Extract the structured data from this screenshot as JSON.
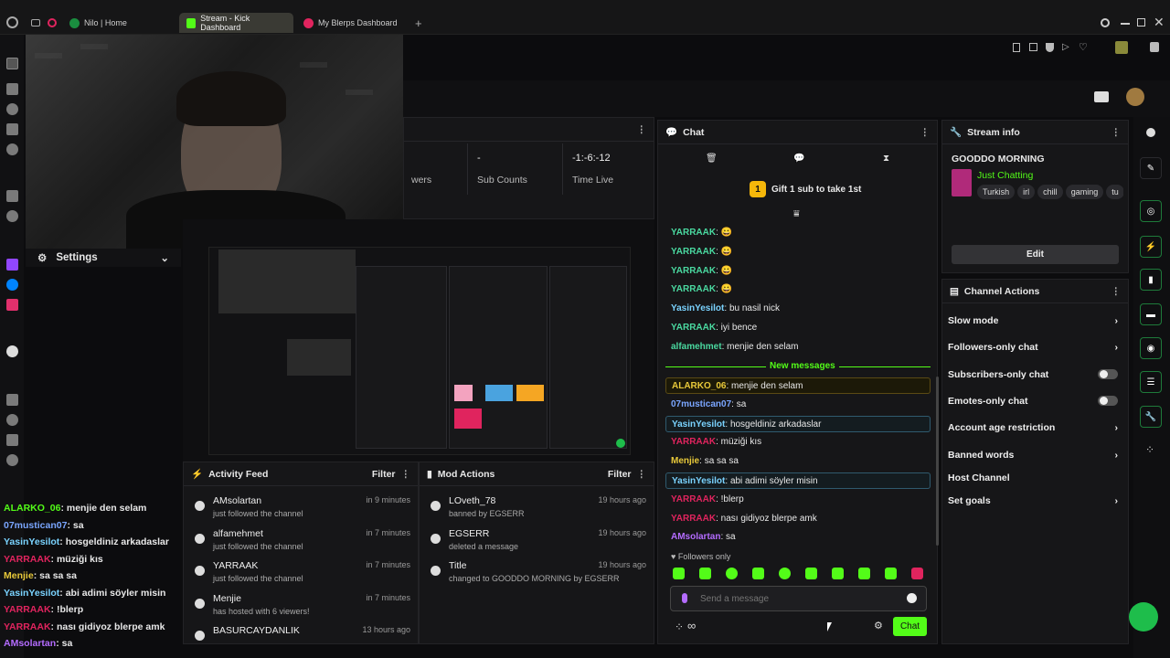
{
  "browser": {
    "tabs": [
      {
        "label": "Nilo | Home",
        "color": "#1a8d3f"
      },
      {
        "label": "Stream - Kick Dashboard",
        "color": "#53fc18"
      },
      {
        "label": "My Blerps Dashboard",
        "color": "#e0245e"
      }
    ],
    "new_tab": "+"
  },
  "settings": {
    "label": "Settings"
  },
  "stats": {
    "viewers_label": "wers",
    "sub_counts_value": "-",
    "sub_counts_label": "Sub Counts",
    "time_live_value": "-1:-6:-12",
    "time_live_label": "Time Live"
  },
  "side_chat": [
    {
      "name": "ALARKO_06",
      "text": "menjie den selam",
      "color": "#53fc18"
    },
    {
      "name": "07mustican07",
      "text": "sa",
      "color": "#7aa6ff"
    },
    {
      "name": "YasinYesilot",
      "text": "hosgeldiniz arkadaslar",
      "color": "#7ad3ff"
    },
    {
      "name": "YARRAAK",
      "text": "müziği kıs",
      "color": "#e0245e"
    },
    {
      "name": "Menjie",
      "text": "sa sa sa",
      "color": "#e8c93a"
    },
    {
      "name": "YasinYesilot",
      "text": "abi adimi söyler misin",
      "color": "#7ad3ff"
    },
    {
      "name": "YARRAAK",
      "text": "!blerp",
      "color": "#e0245e"
    },
    {
      "name": "YARRAAK",
      "text": "nası gidiyoz blerpe amk",
      "color": "#e0245e"
    },
    {
      "name": "AMsolartan",
      "text": "sa",
      "color": "#b46cff"
    }
  ],
  "activity": {
    "title": "Activity Feed",
    "filter": "Filter",
    "items": [
      {
        "name": "AMsolartan",
        "sub": "just followed the channel",
        "time": "in 9 minutes"
      },
      {
        "name": "alfamehmet",
        "sub": "just followed the channel",
        "time": "in 7 minutes"
      },
      {
        "name": "YARRAAK",
        "sub": "just followed the channel",
        "time": "in 7 minutes"
      },
      {
        "name": "Menjie",
        "sub": "has hosted with 6 viewers!",
        "time": "in 7 minutes"
      },
      {
        "name": "BASURCAYDANLIK",
        "sub": "",
        "time": "13 hours ago"
      }
    ]
  },
  "mod_actions": {
    "title": "Mod Actions",
    "filter": "Filter",
    "items": [
      {
        "name": "LOveth_78",
        "sub": "banned by EGSERR",
        "time": "19 hours ago"
      },
      {
        "name": "EGSERR",
        "sub": "deleted a message",
        "time": "19 hours ago"
      },
      {
        "name": "Title",
        "sub": "changed to GOODDO MORNING by EGSERR",
        "time": "19 hours ago"
      }
    ]
  },
  "chat": {
    "title": "Chat",
    "gift_text": "Gift 1 sub to take 1st",
    "gift_rank": "1",
    "new_messages": "New messages",
    "followers_only": "Followers only",
    "placeholder": "Send a message",
    "send_label": "Chat",
    "messages_top": [
      {
        "name": "YARRAAK",
        "text": "😀",
        "color": "#4ad9a0"
      },
      {
        "name": "YARRAAK",
        "text": "😀",
        "color": "#4ad9a0"
      },
      {
        "name": "YARRAAK",
        "text": "😀",
        "color": "#4ad9a0"
      },
      {
        "name": "YARRAAK",
        "text": "😀",
        "color": "#4ad9a0"
      },
      {
        "name": "YasinYesilot",
        "text": "bu nasil nick",
        "color": "#7ad3ff"
      },
      {
        "name": "YARRAAK",
        "text": "iyi bence",
        "color": "#4ad9a0"
      },
      {
        "name": "alfamehmet",
        "text": "menjie den selam",
        "color": "#4ad9a0"
      }
    ],
    "messages_new": [
      {
        "name": "ALARKO_06",
        "text": "menjie den selam",
        "color": "#e8c93a",
        "style": "gold"
      },
      {
        "name": "07mustican07",
        "text": "sa",
        "color": "#7aa6ff",
        "style": ""
      },
      {
        "name": "YasinYesilot",
        "text": "hosgeldiniz arkadaslar",
        "color": "#7ad3ff",
        "style": "hl"
      },
      {
        "name": "YARRAAK",
        "text": "müziği kıs",
        "color": "#e0245e",
        "style": ""
      },
      {
        "name": "Menjie",
        "text": "sa sa sa",
        "color": "#e8c93a",
        "style": ""
      },
      {
        "name": "YasinYesilot",
        "text": "abi adimi söyler misin",
        "color": "#7ad3ff",
        "style": "hl"
      },
      {
        "name": "YARRAAK",
        "text": "!blerp",
        "color": "#e0245e",
        "style": ""
      },
      {
        "name": "YARRAAK",
        "text": "nası gidiyoz blerpe amk",
        "color": "#e0245e",
        "style": ""
      },
      {
        "name": "AMsolartan",
        "text": "sa",
        "color": "#b46cff",
        "style": ""
      }
    ]
  },
  "stream_info": {
    "title": "Stream info",
    "stream_title": "GOODDO MORNING",
    "category": "Just Chatting",
    "tags": [
      "Turkish",
      "irl",
      "chill",
      "gaming",
      "tu"
    ],
    "edit": "Edit"
  },
  "channel_actions": {
    "title": "Channel Actions",
    "items": [
      {
        "label": "Slow mode",
        "control": "chevron"
      },
      {
        "label": "Followers-only chat",
        "control": "chevron"
      },
      {
        "label": "Subscribers-only chat",
        "control": "toggle"
      },
      {
        "label": "Emotes-only chat",
        "control": "toggle"
      },
      {
        "label": "Account age restriction",
        "control": "chevron"
      },
      {
        "label": "Banned words",
        "control": "chevron"
      },
      {
        "label": "Host Channel",
        "control": "none"
      },
      {
        "label": "Set goals",
        "control": "chevron"
      }
    ]
  },
  "colors": {
    "kick_green": "#53fc18",
    "panel": "#161618"
  }
}
